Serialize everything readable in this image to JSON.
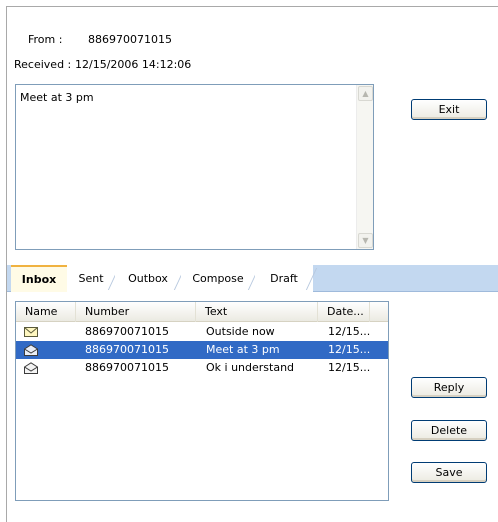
{
  "header": {
    "from_label": "From :",
    "from_value": "886970071015",
    "received_label": "Received :",
    "received_value": "12/15/2006 14:12:06"
  },
  "message": {
    "body": "Meet at 3 pm"
  },
  "buttons": {
    "exit": "Exit",
    "reply": "Reply",
    "delete": "Delete",
    "save": "Save"
  },
  "tabs": [
    {
      "label": "Inbox",
      "active": true
    },
    {
      "label": "Sent",
      "active": false
    },
    {
      "label": "Outbox",
      "active": false
    },
    {
      "label": "Compose",
      "active": false
    },
    {
      "label": "Draft",
      "active": false
    }
  ],
  "list": {
    "columns": [
      "Name",
      "Number",
      "Text",
      "Date..."
    ],
    "rows": [
      {
        "icon": "envelope-unread-icon",
        "number": "886970071015",
        "text": "Outside now",
        "date": "12/15...",
        "selected": false
      },
      {
        "icon": "envelope-read-icon",
        "number": "886970071015",
        "text": "Meet at 3 pm",
        "date": "12/15...",
        "selected": true
      },
      {
        "icon": "envelope-read-icon",
        "number": "886970071015",
        "text": "Ok i understand",
        "date": "12/15...",
        "selected": false
      }
    ]
  },
  "colors": {
    "selection": "#316ac5",
    "tab_strip": "#c3d8f0",
    "active_tab_accent": "#f0b240",
    "button_border": "#003c74"
  }
}
